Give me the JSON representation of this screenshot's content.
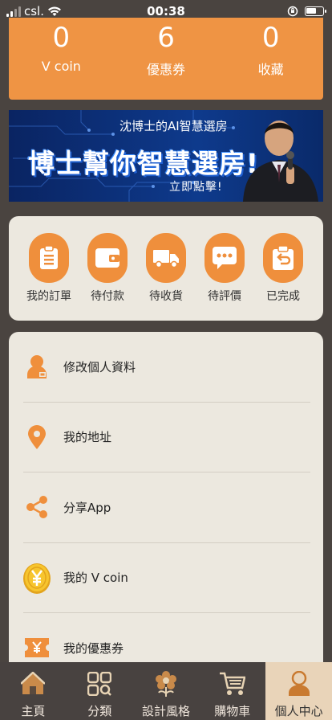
{
  "status_bar": {
    "carrier": "csl.",
    "time": "00:38"
  },
  "stats": [
    {
      "value": "0",
      "label": "V coin"
    },
    {
      "value": "6",
      "label": "優惠券"
    },
    {
      "value": "0",
      "label": "收藏"
    }
  ],
  "banner": {
    "subtitle": "沈博士的AI智慧選房",
    "headline": "博士幫你智慧選房!",
    "cta": "立即點擊!"
  },
  "orders": [
    {
      "label": "我的訂單",
      "icon": "clipboard-icon"
    },
    {
      "label": "待付款",
      "icon": "wallet-icon"
    },
    {
      "label": "待收貨",
      "icon": "truck-icon"
    },
    {
      "label": "待評價",
      "icon": "chat-bubble-icon"
    },
    {
      "label": "已完成",
      "icon": "return-box-icon"
    }
  ],
  "menu": [
    {
      "label": "修改個人資料",
      "icon": "user-profile-icon"
    },
    {
      "label": "我的地址",
      "icon": "location-pin-icon"
    },
    {
      "label": "分享App",
      "icon": "share-icon"
    },
    {
      "label": "我的 V coin",
      "icon": "coin-icon"
    },
    {
      "label": "我的優惠券",
      "icon": "coupon-icon"
    }
  ],
  "tabs": [
    {
      "label": "主頁",
      "icon": "home-icon"
    },
    {
      "label": "分類",
      "icon": "category-icon"
    },
    {
      "label": "設計風格",
      "icon": "flower-icon"
    },
    {
      "label": "購物車",
      "icon": "cart-icon"
    },
    {
      "label": "個人中心",
      "icon": "person-icon",
      "active": true
    }
  ],
  "colors": {
    "accent": "#ef9444",
    "background": "#4a4440",
    "card": "#ece8df",
    "active_tab": "#e9d4b9"
  }
}
